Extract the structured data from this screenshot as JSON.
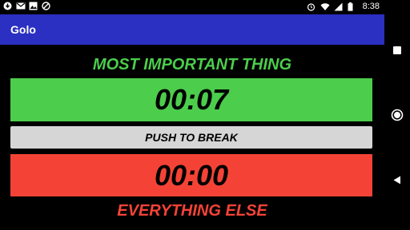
{
  "status_bar": {
    "time": "8:38",
    "left_icons": [
      "download-icon",
      "gmail-icon",
      "image-icon",
      "blocked-icon"
    ],
    "right_icons": [
      "alarm-icon",
      "wifi-icon",
      "signal-icon",
      "battery-icon"
    ]
  },
  "app": {
    "title": "Golo",
    "accent_color": "#2b2fc2"
  },
  "important": {
    "heading": "MOST IMPORTANT THING",
    "timer": "00:07",
    "color": "#4ccd4c"
  },
  "break_button": {
    "label": "PUSH TO BREAK",
    "color": "#d6d6d6"
  },
  "else": {
    "heading": "EVERYTHING ELSE",
    "timer": "00:00",
    "color": "#f44336"
  },
  "nav_bar": {
    "buttons": [
      "recents-square-icon",
      "home-circle-icon",
      "back-triangle-icon"
    ]
  }
}
